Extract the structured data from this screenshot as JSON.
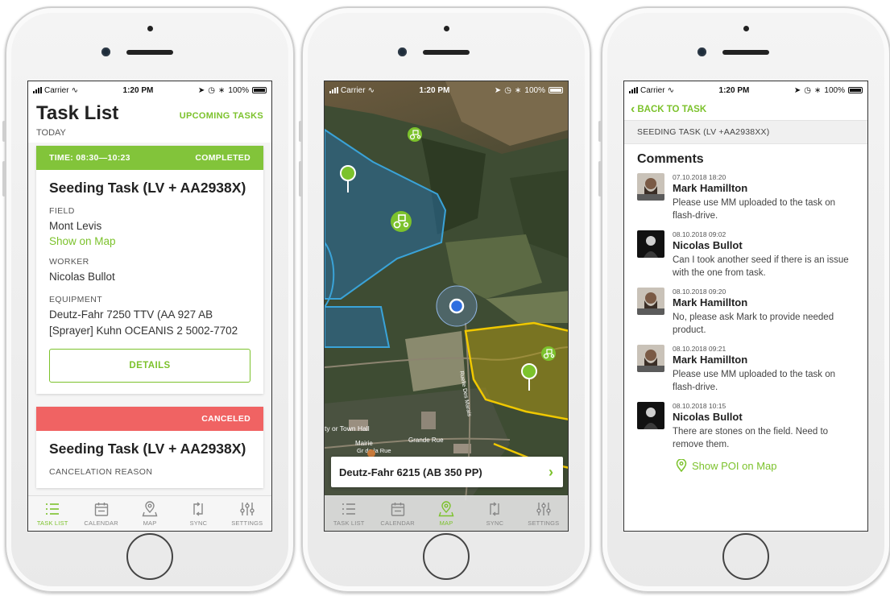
{
  "colors": {
    "accent": "#7cc22c",
    "completed": "#82c43a",
    "canceled": "#f06363"
  },
  "status_bar": {
    "carrier": "Carrier",
    "time": "1:20 PM",
    "battery": "100%"
  },
  "tabs": [
    {
      "label": "TASK LIST",
      "icon": "list-icon"
    },
    {
      "label": "CALENDAR",
      "icon": "calendar-icon"
    },
    {
      "label": "MAP",
      "icon": "map-pin-icon"
    },
    {
      "label": "SYNC",
      "icon": "sync-icon"
    },
    {
      "label": "SETTINGS",
      "icon": "sliders-icon"
    }
  ],
  "task_list": {
    "title": "Task List",
    "upcoming_link": "UPCOMING TASKS",
    "section": "TODAY",
    "cards": [
      {
        "time": "TIME: 08:30—10:23",
        "status": "COMPLETED",
        "title": "Seeding Task (LV + AA2938X)",
        "field_label": "FIELD",
        "field_value": "Mont Levis",
        "show_on_map": "Show on Map",
        "worker_label": "WORKER",
        "worker_value": "Nicolas Bullot",
        "equipment_label": "EQUIPMENT",
        "equipment_line1": "Deutz-Fahr 7250 TTV (AA 927 AB",
        "equipment_line2": "[Sprayer] Kuhn OCEANIS 2 5002-7702",
        "details_button": "DETAILS"
      },
      {
        "status": "CANCELED",
        "title": "Seeding Task (LV + AA2938X)",
        "reason_label": "CANCELATION REASON"
      }
    ]
  },
  "map_screen": {
    "equipment_card": "Deutz-Fahr 6215 (AB 350 PP)",
    "map_labels": {
      "town_hall": "ty or Town Hall",
      "mairie": "Mairie",
      "rue1": "Gr de la Rue",
      "rue2": "Grande Rue",
      "road": "Ruelle Des Marais"
    }
  },
  "comments_screen": {
    "back": "BACK TO TASK",
    "subheader": "SEEDING TASK (LV +AA2938XX)",
    "title": "Comments",
    "comments": [
      {
        "date": "07.10.2018 18:20",
        "name": "Mark Hamillton",
        "text": "Please use MM uploaded to the task on flash-drive.",
        "avatar": "bearded"
      },
      {
        "date": "08.10.2018 09:02",
        "name": "Nicolas Bullot",
        "text": "Can I took another seed if there is an issue with the one from task.",
        "avatar": "dark"
      },
      {
        "date": "08.10.2018 09:20",
        "name": "Mark Hamillton",
        "text": "No, please ask Mark to provide needed product.",
        "avatar": "bearded"
      },
      {
        "date": "08.10.2018 09:21",
        "name": "Mark Hamillton",
        "text": "Please use MM uploaded to the task on flash-drive.",
        "avatar": "bearded"
      },
      {
        "date": "08.10.2018 10:15",
        "name": "Nicolas Bullot",
        "text": "There are stones on the field. Need to remove them.",
        "avatar": "dark"
      }
    ],
    "poi_link": "Show POI on Map"
  }
}
